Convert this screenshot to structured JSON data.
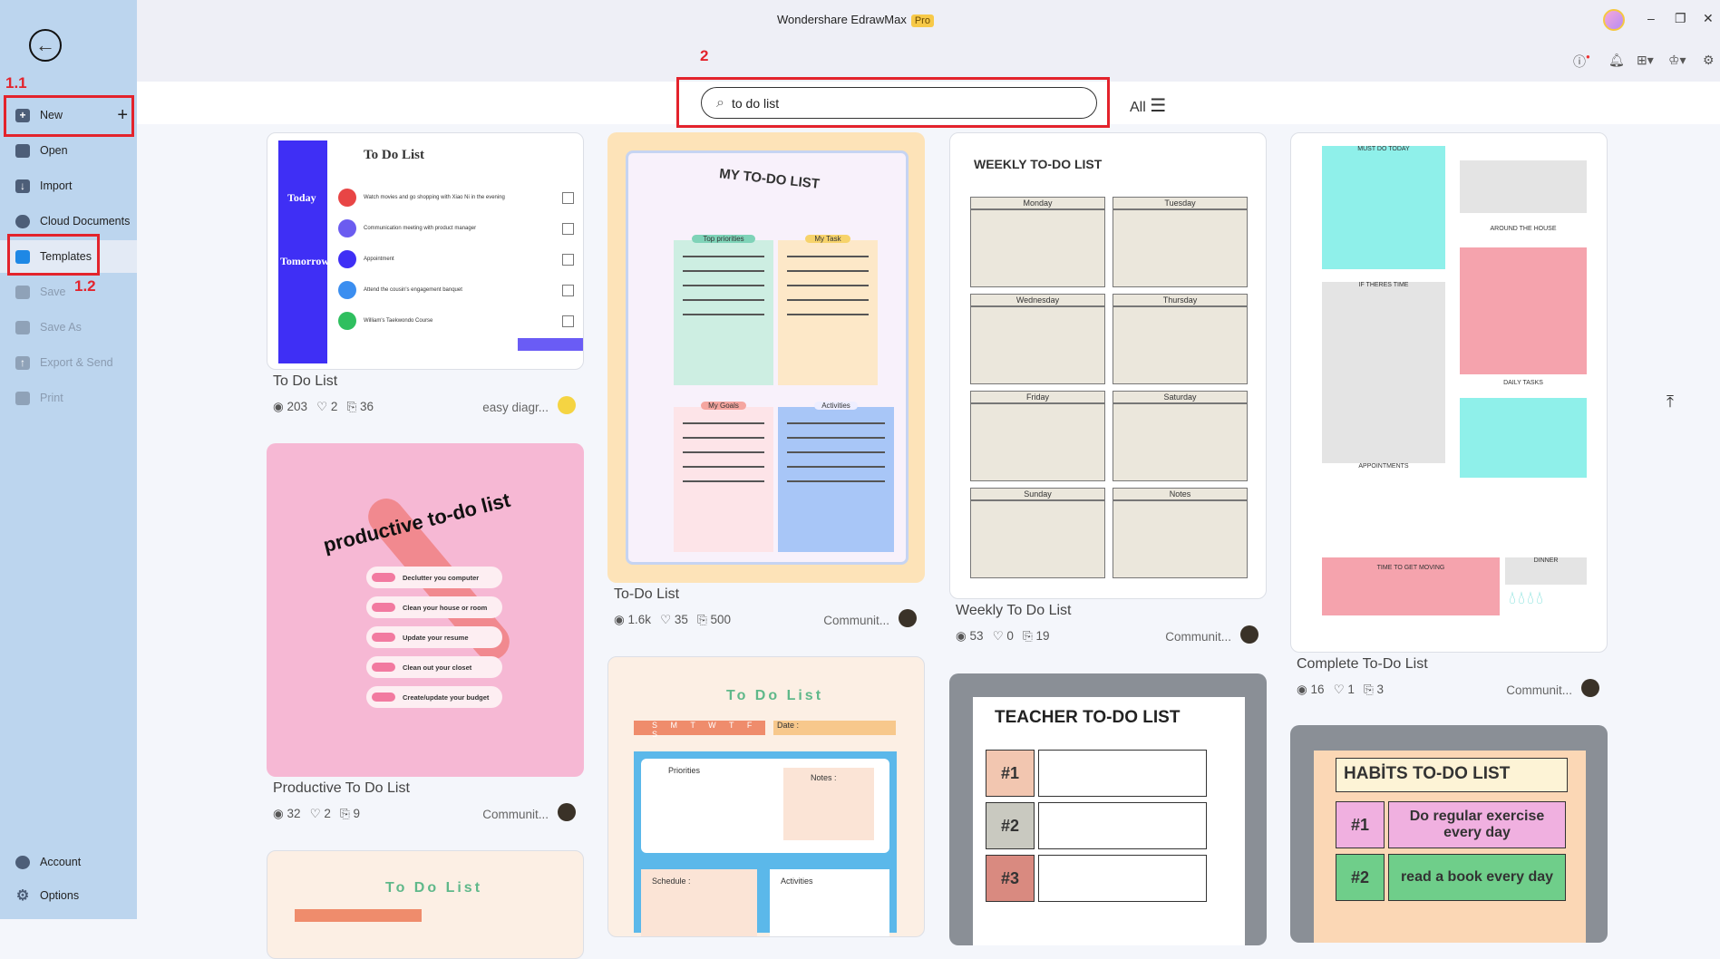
{
  "app": {
    "title": "Wondershare EdrawMax",
    "badge": "Pro"
  },
  "sidebar": {
    "items": [
      {
        "label": "New",
        "icon": "plus-square-icon"
      },
      {
        "label": "Open",
        "icon": "folder-icon"
      },
      {
        "label": "Import",
        "icon": "import-icon"
      },
      {
        "label": "Cloud Documents",
        "icon": "cloud-icon"
      },
      {
        "label": "Templates",
        "icon": "templates-icon"
      },
      {
        "label": "Save",
        "icon": "save-icon"
      },
      {
        "label": "Save As",
        "icon": "save-as-icon"
      },
      {
        "label": "Export & Send",
        "icon": "export-icon"
      },
      {
        "label": "Print",
        "icon": "print-icon"
      }
    ],
    "bottom": [
      {
        "label": "Account",
        "icon": "account-icon"
      },
      {
        "label": "Options",
        "icon": "gear-icon"
      }
    ]
  },
  "annotations": {
    "a1": "1.1",
    "a2": "1.2",
    "a3": "2",
    "color": "#e3232c"
  },
  "search": {
    "value": "to do list",
    "filter": "All"
  },
  "cards": [
    {
      "title": "To Do List",
      "views": "203",
      "likes": "2",
      "copies": "36",
      "author": "easy diagr...",
      "thumb": {
        "heading": "To Do List",
        "left1": "Today",
        "left2": "Tomorrow",
        "items": [
          "Watch movies and go shopping with Xiao Ni in the evening",
          "Communication meeting with product manager",
          "Appointment",
          "Attend the cousin's engagement banquet",
          "William's Taekwondo Course"
        ]
      }
    },
    {
      "title": "Productive To Do List",
      "views": "32",
      "likes": "2",
      "copies": "9",
      "author": "Communit...",
      "thumb": {
        "heading": "productive to-do list",
        "items": [
          "Declutter you computer",
          "Clean your house or room",
          "Update your resume",
          "Clean out your closet",
          "Create/update your budget"
        ]
      }
    },
    {
      "title": "To-Do List",
      "views": "1.6k",
      "likes": "35",
      "copies": "500",
      "author": "Communit...",
      "thumb": {
        "heading": "MY TO-DO LIST",
        "boxes": [
          "Top priorities",
          "My Task",
          "My Goals",
          "Activities"
        ]
      }
    },
    {
      "title": "Weekly To Do List",
      "views": "53",
      "likes": "0",
      "copies": "19",
      "author": "Communit...",
      "thumb": {
        "heading": "WEEKLY TO-DO LIST",
        "days": [
          "Monday",
          "Tuesday",
          "Wednesday",
          "Thursday",
          "Friday",
          "Saturday",
          "Sunday",
          "Notes"
        ]
      }
    },
    {
      "title": "Complete To-Do List",
      "views": "16",
      "likes": "1",
      "copies": "3",
      "author": "Communit...",
      "thumb": {
        "sections": [
          "MUST DO TODAY",
          "AROUND THE HOUSE",
          "IF THERES TIME",
          "DAILY TASKS",
          "APPOINTMENTS",
          "TIME TO GET MOVING",
          "DINNER"
        ]
      }
    }
  ],
  "partial": {
    "todo2": {
      "heading": "To Do List",
      "days": "S M T W T F S",
      "date": "Date :",
      "priorities": "Priorities",
      "notes": "Notes :",
      "schedule": "Schedule :",
      "activities": "Activities"
    },
    "teacher": {
      "heading": "TEACHER TO-DO LIST",
      "rows": [
        "#1",
        "#2",
        "#3"
      ]
    },
    "habits": {
      "heading": "HABİTS TO-DO LIST",
      "rows": [
        {
          "n": "#1",
          "t": "Do regular exercise every day"
        },
        {
          "n": "#2",
          "t": "read a book every day"
        }
      ]
    }
  }
}
